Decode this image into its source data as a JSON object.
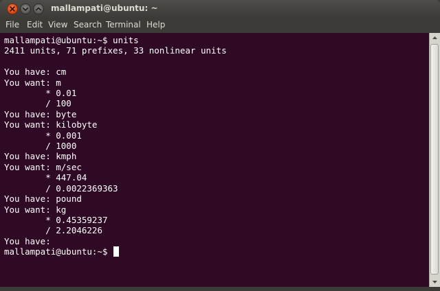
{
  "window": {
    "title": "mallampati@ubuntu: ~"
  },
  "icons": {
    "close": "close-icon",
    "minimize": "minimize-icon",
    "maximize": "maximize-icon",
    "scroll_up": "chevron-up-icon",
    "scroll_down": "chevron-down-icon"
  },
  "colors": {
    "terminal_background": "#2f0a24",
    "terminal_text": "#ffffff",
    "chrome": "#3c3b37",
    "close_button": "#df4a16"
  },
  "menu": {
    "items": [
      "File",
      "Edit",
      "View",
      "Search",
      "Terminal",
      "Help"
    ]
  },
  "terminal": {
    "lines": [
      "mallampati@ubuntu:~$ units",
      "2411 units, 71 prefixes, 33 nonlinear units",
      "",
      "You have: cm",
      "You want: m",
      "        * 0.01",
      "        / 100",
      "You have: byte",
      "You want: kilobyte",
      "        * 0.001",
      "        / 1000",
      "You have: kmph",
      "You want: m/sec",
      "        * 447.04",
      "        / 0.0022369363",
      "You have: pound",
      "You want: kg",
      "        * 0.45359237",
      "        / 2.2046226",
      "You have:"
    ],
    "current_prompt": "mallampati@ubuntu:~$ "
  }
}
